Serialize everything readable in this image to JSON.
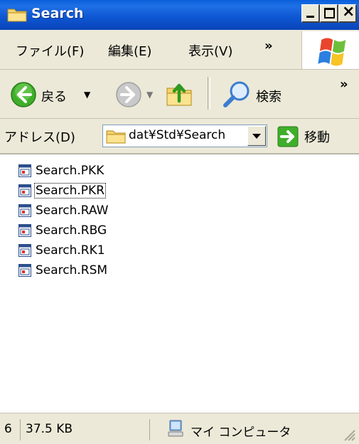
{
  "window": {
    "title": "Search"
  },
  "menu": {
    "file": "ファイル(F)",
    "edit": "編集(E)",
    "view": "表示(V)",
    "more": "»"
  },
  "toolbar": {
    "back": "戻る",
    "search": "検索",
    "more": "»"
  },
  "address": {
    "label": "アドレス(D)",
    "value": "dat¥Std¥Search",
    "go": "移動"
  },
  "files": [
    {
      "name": "Search.PKK"
    },
    {
      "name": "Search.PKR"
    },
    {
      "name": "Search.RAW"
    },
    {
      "name": "Search.RBG"
    },
    {
      "name": "Search.RK1"
    },
    {
      "name": "Search.RSM"
    }
  ],
  "status": {
    "count": "6",
    "size": "37.5 KB",
    "location": "マイ コンピュータ"
  }
}
